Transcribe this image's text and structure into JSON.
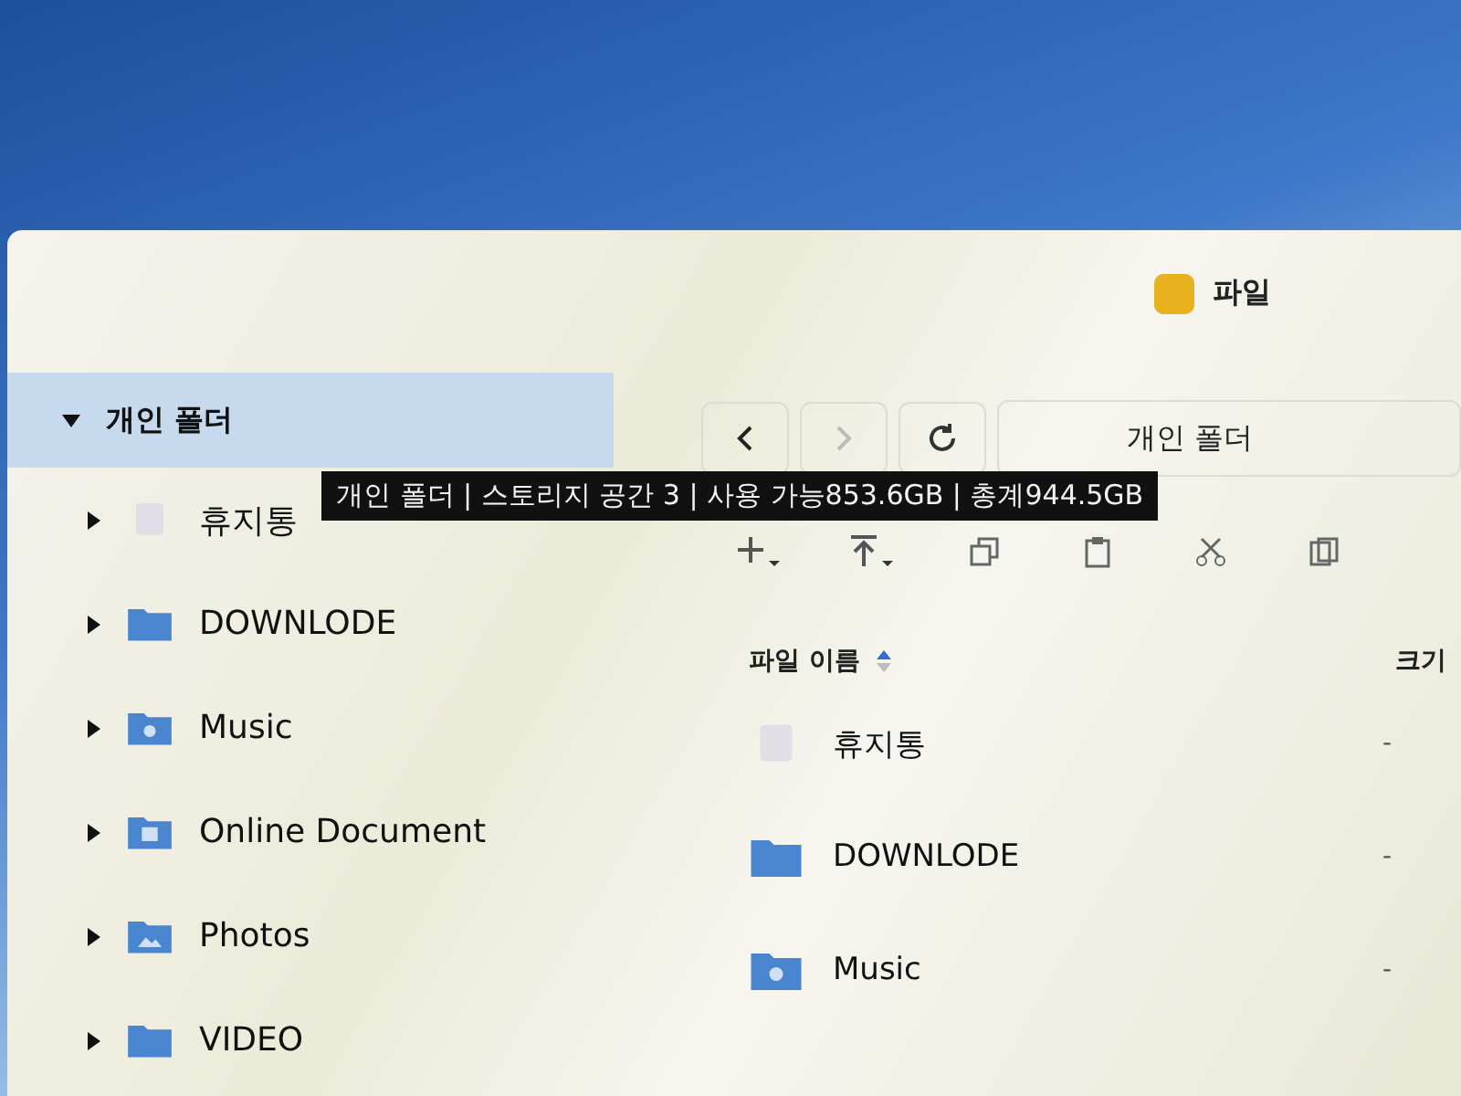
{
  "window": {
    "title": "파일"
  },
  "sidebar": {
    "tree": [
      {
        "label": "개인 폴더",
        "expanded": true,
        "selected": true,
        "kind": "root",
        "children": [
          {
            "label": "휴지통",
            "expanded": false,
            "selected": false,
            "kind": "trash"
          },
          {
            "label": "DOWNLODE",
            "expanded": false,
            "selected": false,
            "kind": "folder"
          },
          {
            "label": "Music",
            "expanded": false,
            "selected": false,
            "kind": "music"
          },
          {
            "label": "Online Document",
            "expanded": false,
            "selected": false,
            "kind": "document"
          },
          {
            "label": "Photos",
            "expanded": false,
            "selected": false,
            "kind": "photo"
          },
          {
            "label": "VIDEO",
            "expanded": false,
            "selected": false,
            "kind": "folder"
          }
        ]
      }
    ]
  },
  "tooltip": "개인 폴더 | 스토리지 공간 3  | 사용 가능853.6GB | 총계944.5GB",
  "navigation": {
    "back_disabled": false,
    "forward_disabled": true,
    "path": "개인 폴더"
  },
  "table": {
    "columns": [
      "파일 이름",
      "크기"
    ],
    "rows": [
      {
        "name": "휴지통",
        "size": "-",
        "kind": "trash"
      },
      {
        "name": "DOWNLODE",
        "size": "-",
        "kind": "folder"
      },
      {
        "name": "Music",
        "size": "-",
        "kind": "music"
      }
    ]
  }
}
